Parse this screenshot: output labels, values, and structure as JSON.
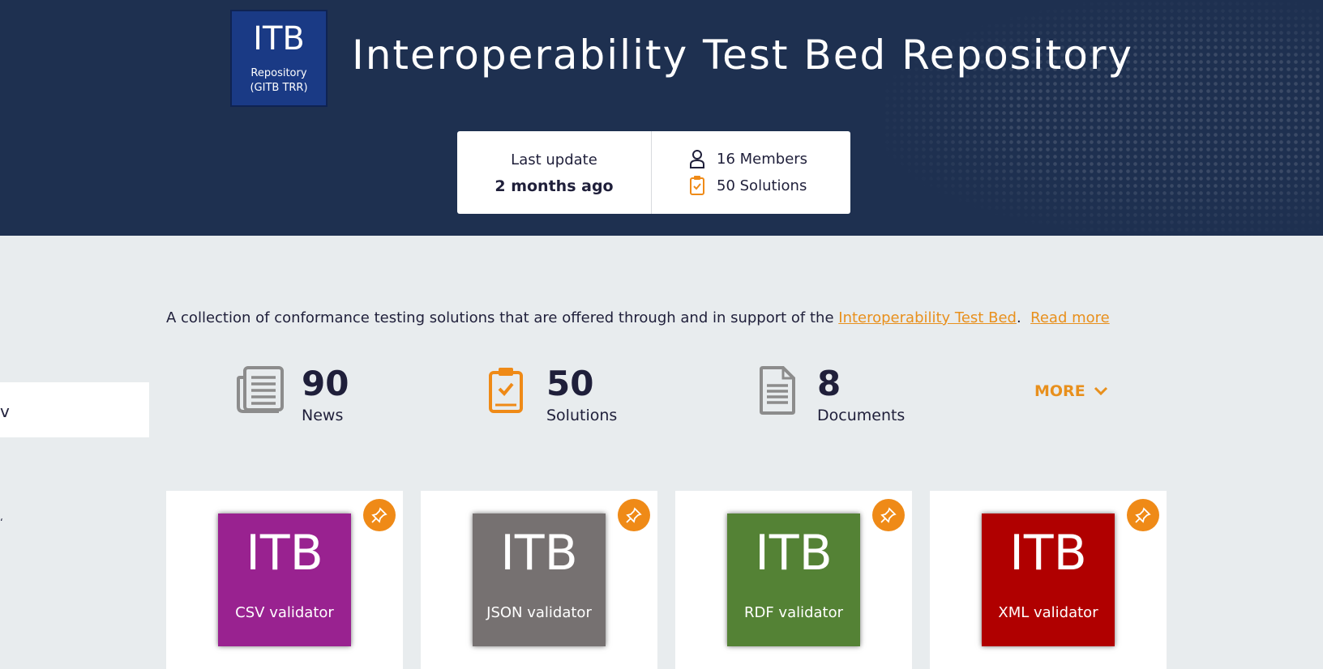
{
  "header": {
    "logo": {
      "main": "ITB",
      "line1": "Repository",
      "line2": "(GITB TRR)"
    },
    "title": "Interoperability Test Bed Repository",
    "stats": {
      "last_update_label": "Last update",
      "last_update_value": "2 months ago",
      "members": "16 Members",
      "solutions": "50 Solutions"
    }
  },
  "description": {
    "text": "A collection of conformance testing solutions that are offered through and in support of the ",
    "link": "Interoperability Test Bed",
    "period": ".",
    "read_more": "Read more"
  },
  "sidebar": {
    "tab_glyph": "v"
  },
  "counts": [
    {
      "icon": "news-icon",
      "value": "90",
      "label": "News"
    },
    {
      "icon": "solutions-icon",
      "value": "50",
      "label": "Solutions"
    },
    {
      "icon": "documents-icon",
      "value": "8",
      "label": "Documents"
    }
  ],
  "more_label": "MORE",
  "cards": [
    {
      "main": "ITB",
      "caption": "CSV validator",
      "color": "#992290"
    },
    {
      "main": "ITB",
      "caption": "JSON validator",
      "color": "#767171"
    },
    {
      "main": "ITB",
      "caption": "RDF validator",
      "color": "#548235"
    },
    {
      "main": "ITB",
      "caption": "XML validator",
      "color": "#b00000"
    }
  ],
  "colors": {
    "header_bg": "#1e3050",
    "accent": "#e8901d",
    "page_bg": "#e8ecee"
  }
}
